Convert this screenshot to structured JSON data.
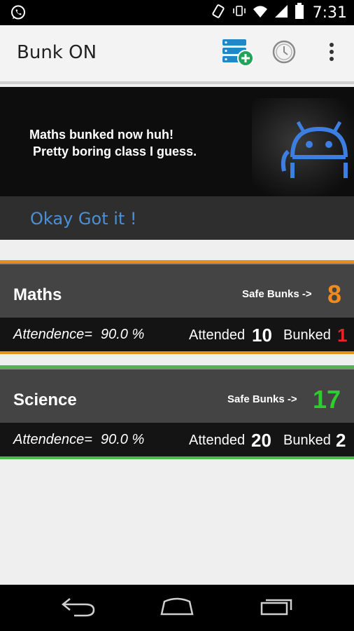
{
  "status_bar": {
    "time": "7:31",
    "icons": [
      "whatsapp-icon",
      "rotate-icon",
      "vibrate-icon",
      "wifi-icon",
      "signal-icon",
      "battery-icon"
    ]
  },
  "app_bar": {
    "title": "Bunk ON",
    "actions": [
      "add-subject-icon",
      "history-icon",
      "overflow-menu-icon"
    ],
    "accent_color": "#1e88c8",
    "add_badge_color": "#22a35a"
  },
  "banner": {
    "message": "Maths bunked now huh!\n Pretty boring class I guess.",
    "action_label": "Okay Got it !",
    "action_color": "#4a90d9"
  },
  "subjects": [
    {
      "name": "Maths",
      "safe_bunks_label": "Safe Bunks ->",
      "safe_bunks": "8",
      "safe_color": "#f08a1c",
      "attendance_label": "Attendence=",
      "attendance_value": "90.0 %",
      "attended_label": "Attended",
      "attended": "10",
      "bunked_label": "Bunked",
      "bunked": "1",
      "bunked_color": "#ee2222",
      "line_color": "#e8901f"
    },
    {
      "name": "Science",
      "safe_bunks_label": "Safe Bunks ->",
      "safe_bunks": "17",
      "safe_color": "#2ecc2e",
      "attendance_label": "Attendence=",
      "attendance_value": "90.0 %",
      "attended_label": "Attended",
      "attended": "20",
      "bunked_label": "Bunked",
      "bunked": "2",
      "bunked_color": "#ffffff",
      "line_color": "#4cb84c"
    }
  ],
  "nav_bar": {
    "buttons": [
      "back-icon",
      "home-icon",
      "recent-apps-icon"
    ]
  }
}
